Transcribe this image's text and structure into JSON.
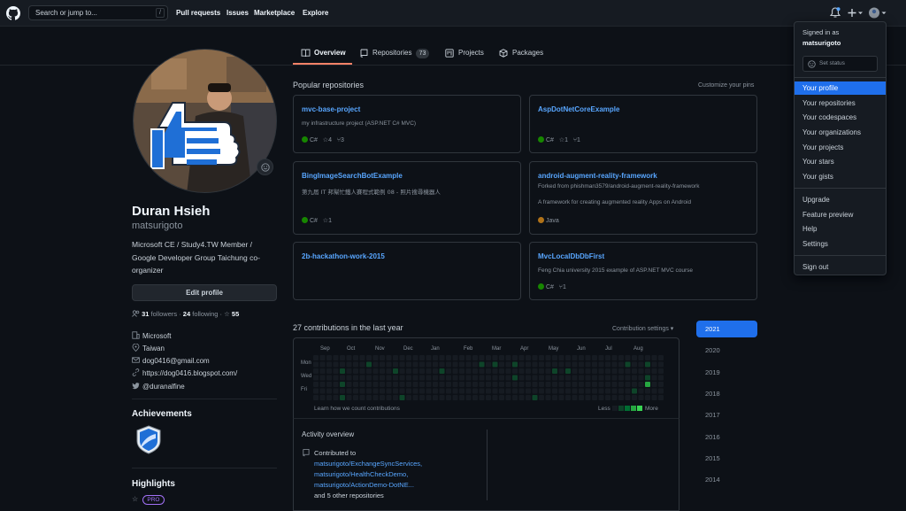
{
  "header": {
    "search_placeholder": "Search or jump to...",
    "search_shortcut": "/",
    "nav": [
      "Pull requests",
      "Issues",
      "Marketplace",
      "Explore"
    ]
  },
  "tabs": [
    {
      "label": "Overview",
      "icon": "book-icon",
      "selected": true
    },
    {
      "label": "Repositories",
      "icon": "repo-icon",
      "count": "73"
    },
    {
      "label": "Projects",
      "icon": "project-icon"
    },
    {
      "label": "Packages",
      "icon": "package-icon"
    }
  ],
  "profile": {
    "name": "Duran Hsieh",
    "username": "matsurigoto",
    "bio_lines": [
      "Microsoft CE / Study4.TW Member /",
      "Google Developer Group Taichung co-",
      "organizer"
    ],
    "edit_label": "Edit profile",
    "followers_count": "31",
    "followers_label": "followers",
    "following_count": "24",
    "following_label": "following",
    "stars": "55",
    "company": "Microsoft",
    "location": "Taiwan",
    "email": "dog0416@gmail.com",
    "website": "https://dog0416.blogspot.com/",
    "twitter": "@duranalfine",
    "achievements_title": "Achievements",
    "highlights_title": "Highlights",
    "pro_label": "PRO"
  },
  "popular": {
    "title": "Popular repositories",
    "customize": "Customize your pins",
    "repos": [
      {
        "name": "mvc-base-project",
        "desc": "my infrastructure project (ASP.NET C# MVC)",
        "lang": "C#",
        "lang_color": "#178600",
        "stars": "4",
        "forks": "3"
      },
      {
        "name": "AspDotNetCoreExample",
        "desc": "",
        "lang": "C#",
        "lang_color": "#178600",
        "stars": "1",
        "forks": "1"
      },
      {
        "name": "BingImageSearchBotExample",
        "desc": "第九屆 IT 邦幫忙鐵人賽程式範例 08 - 照片搜尋機器人",
        "lang": "C#",
        "lang_color": "#178600",
        "stars": "1",
        "forks": ""
      },
      {
        "name": "android-augment-reality-framework",
        "fork_note": "Forked from phishman3579/android-augment-reality-framework",
        "desc": "A framework for creating augmented reality Apps on Android",
        "lang": "Java",
        "lang_color": "#b07219",
        "stars": "",
        "forks": ""
      },
      {
        "name": "2b-hackathon-work-2015",
        "desc": "",
        "lang": "",
        "stars": "",
        "forks": ""
      },
      {
        "name": "MvcLocalDbDbFirst",
        "desc": "Feng Chia university 2015 example of ASP.NET MVC course",
        "lang": "C#",
        "lang_color": "#178600",
        "stars": "",
        "forks": "1"
      }
    ]
  },
  "contributions": {
    "title": "27 contributions in the last year",
    "settings": "Contribution settings",
    "months": [
      "Sep",
      "Oct",
      "Nov",
      "Dec",
      "Jan",
      "Feb",
      "Mar",
      "Apr",
      "May",
      "Jun",
      "Jul",
      "Aug"
    ],
    "days": [
      "Mon",
      "Wed",
      "Fri"
    ],
    "learn": "Learn how we count contributions",
    "less": "Less",
    "more": "More",
    "active_cells": [
      [
        4,
        2
      ],
      [
        4,
        4
      ],
      [
        4,
        6
      ],
      [
        8,
        1
      ],
      [
        12,
        2
      ],
      [
        13,
        6
      ],
      [
        16,
        7
      ],
      [
        19,
        2
      ],
      [
        25,
        1
      ],
      [
        26,
        7
      ],
      [
        27,
        1
      ],
      [
        30,
        1
      ],
      [
        30,
        3
      ],
      [
        33,
        6
      ],
      [
        36,
        2
      ],
      [
        38,
        2
      ],
      [
        47,
        1
      ],
      [
        48,
        5
      ],
      [
        50,
        1
      ],
      [
        50,
        3
      ],
      [
        59,
        4
      ],
      [
        60,
        2
      ],
      [
        62,
        5
      ],
      [
        70,
        4
      ],
      [
        72,
        1
      ],
      [
        76,
        2
      ],
      [
        77,
        6
      ]
    ],
    "bright_cells": [
      [
        50,
        4
      ]
    ],
    "years": [
      "2021",
      "2020",
      "2019",
      "2018",
      "2017",
      "2016",
      "2015",
      "2014"
    ],
    "selected_year": "2021"
  },
  "activity": {
    "title": "Activity overview",
    "contributed_to": "Contributed to",
    "repos": [
      "matsurigoto/ExchangeSyncServices,",
      "matsurigoto/HealthCheckDemo,",
      "matsurigoto/ActionDemo-DotNE..."
    ],
    "others": "and 5 other repositories"
  },
  "menu": {
    "signed_in_as": "Signed in as",
    "user": "matsurigoto",
    "set_status": "Set status",
    "group1": [
      "Your profile",
      "Your repositories",
      "Your codespaces",
      "Your organizations",
      "Your projects",
      "Your stars",
      "Your gists"
    ],
    "group2": [
      "Upgrade",
      "Feature preview",
      "Help",
      "Settings"
    ],
    "signout": "Sign out",
    "selected": "Your profile"
  },
  "colors": {
    "accent": "#1f6feb",
    "link": "#58a6ff",
    "tab_underline": "#f78166",
    "green_cell": "#0e4429",
    "bright_cell": "#26a641",
    "empty_cell": "#161b22"
  }
}
